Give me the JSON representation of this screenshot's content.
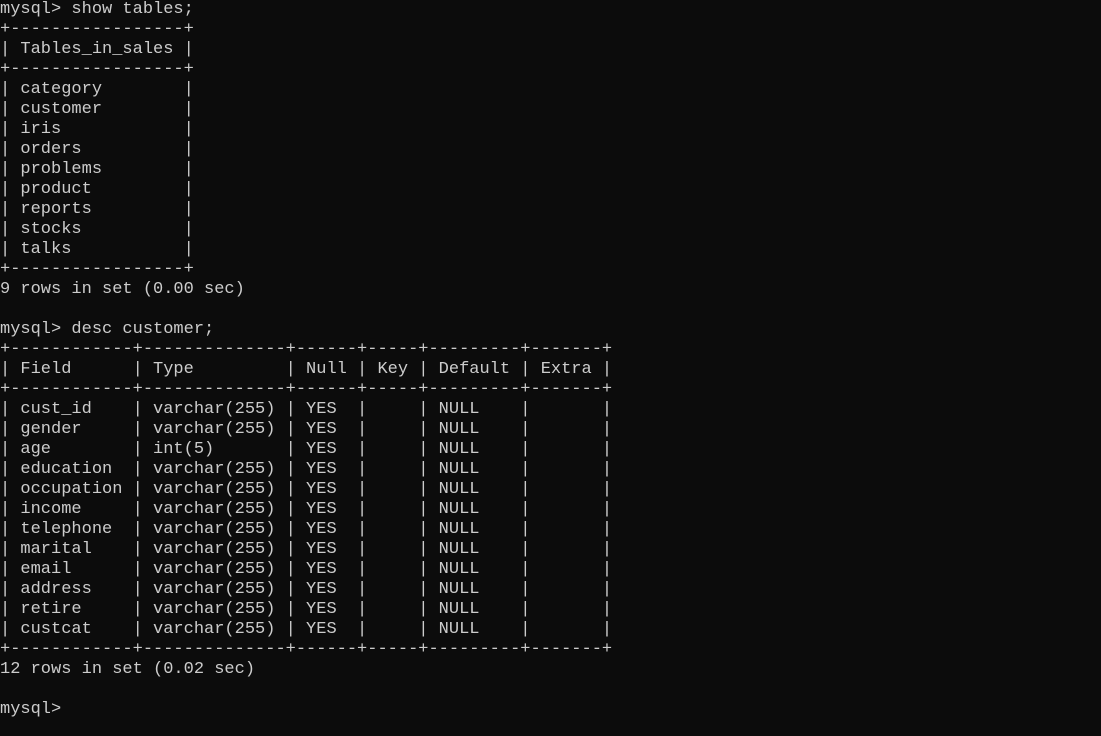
{
  "terminal": {
    "theme": {
      "background": "#0c0c0c",
      "foreground": "#cccccc"
    },
    "lines": [
      "mysql> show tables;",
      "+-----------------+",
      "| Tables_in_sales |",
      "+-----------------+",
      "| category        |",
      "| customer        |",
      "| iris            |",
      "| orders          |",
      "| problems        |",
      "| product         |",
      "| reports         |",
      "| stocks          |",
      "| talks           |",
      "+-----------------+",
      "9 rows in set (0.00 sec)",
      "",
      "mysql> desc customer;",
      "+------------+--------------+------+-----+---------+-------+",
      "| Field      | Type         | Null | Key | Default | Extra |",
      "+------------+--------------+------+-----+---------+-------+",
      "| cust_id    | varchar(255) | YES  |     | NULL    |       |",
      "| gender     | varchar(255) | YES  |     | NULL    |       |",
      "| age        | int(5)       | YES  |     | NULL    |       |",
      "| education  | varchar(255) | YES  |     | NULL    |       |",
      "| occupation | varchar(255) | YES  |     | NULL    |       |",
      "| income     | varchar(255) | YES  |     | NULL    |       |",
      "| telephone  | varchar(255) | YES  |     | NULL    |       |",
      "| marital    | varchar(255) | YES  |     | NULL    |       |",
      "| email      | varchar(255) | YES  |     | NULL    |       |",
      "| address    | varchar(255) | YES  |     | NULL    |       |",
      "| retire     | varchar(255) | YES  |     | NULL    |       |",
      "| custcat    | varchar(255) | YES  |     | NULL    |       |",
      "+------------+--------------+------+-----+---------+-------+",
      "12 rows in set (0.02 sec)",
      "",
      "mysql>"
    ]
  }
}
